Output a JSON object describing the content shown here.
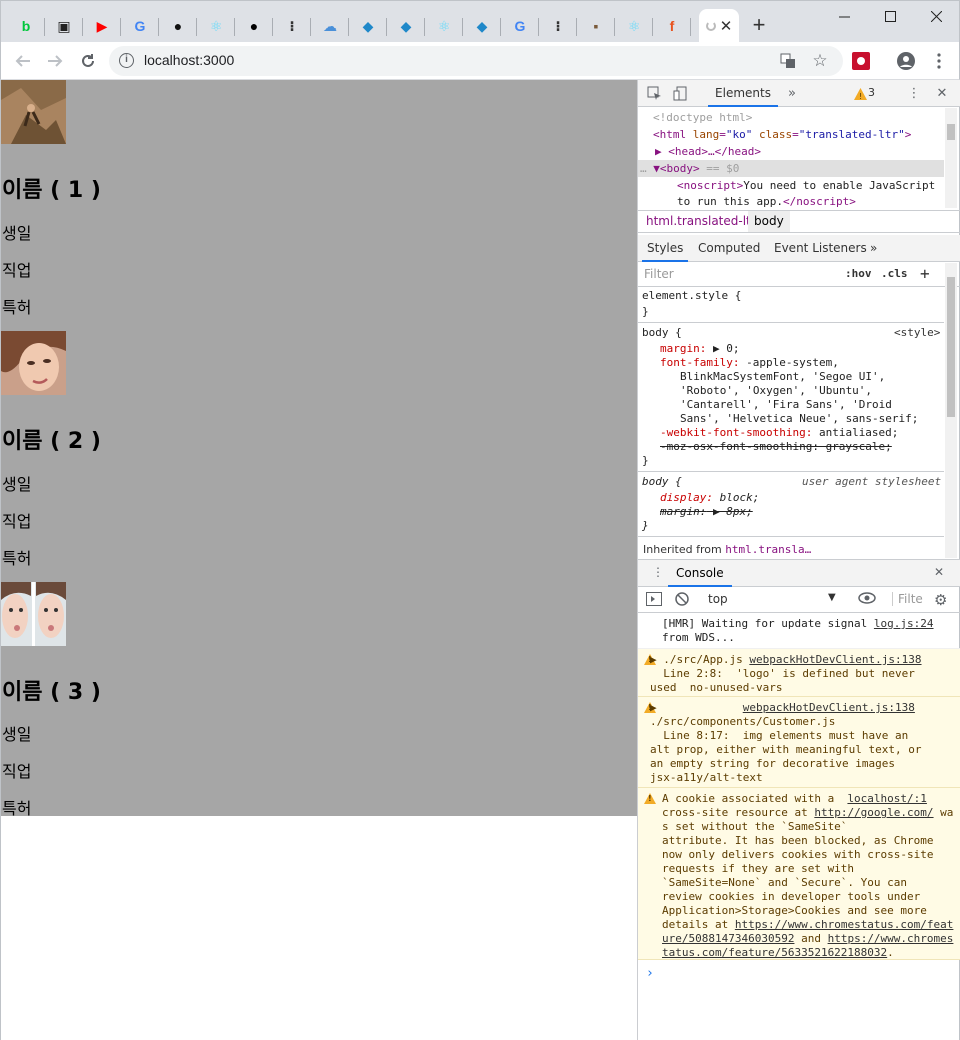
{
  "browser": {
    "url": "localhost:3000",
    "tabs": [
      {
        "icon": "line-blog-favicon",
        "color": "#00c73c",
        "glyph": "b"
      },
      {
        "icon": "codesandbox-favicon",
        "color": "#222222",
        "glyph": "▣"
      },
      {
        "icon": "youtube-favicon",
        "color": "#ff0000",
        "glyph": "▶"
      },
      {
        "icon": "google-favicon",
        "color": "#4285f4",
        "glyph": "G"
      },
      {
        "icon": "github-favicon",
        "color": "#111111",
        "glyph": "●"
      },
      {
        "icon": "react-favicon",
        "color": "#61dafb",
        "glyph": "⚛"
      },
      {
        "icon": "black-circle-favicon",
        "color": "#000000",
        "glyph": "●"
      },
      {
        "icon": "dots-favicon",
        "color": "#333333",
        "glyph": "⁝"
      },
      {
        "icon": "cloud-favicon",
        "color": "#4a90d9",
        "glyph": "☁"
      },
      {
        "icon": "panther-favicon",
        "color": "#1f88c9",
        "glyph": "◆"
      },
      {
        "icon": "panther-favicon",
        "color": "#1f88c9",
        "glyph": "◆"
      },
      {
        "icon": "react-favicon",
        "color": "#61dafb",
        "glyph": "⚛"
      },
      {
        "icon": "panther-favicon",
        "color": "#1f88c9",
        "glyph": "◆"
      },
      {
        "icon": "google-favicon",
        "color": "#4285f4",
        "glyph": "G"
      },
      {
        "icon": "dots-favicon",
        "color": "#333333",
        "glyph": "⁝"
      },
      {
        "icon": "photo-favicon",
        "color": "#7a5a3a",
        "glyph": "▪"
      },
      {
        "icon": "react-favicon",
        "color": "#61dafb",
        "glyph": "⚛"
      },
      {
        "icon": "orange-logo-favicon",
        "color": "#e8531f",
        "glyph": "f"
      }
    ],
    "active_tab_close": "✕",
    "new_tab": "+"
  },
  "page": {
    "customers": [
      {
        "name": "이름 ( 1 )",
        "birthday": "생일",
        "job": "직업",
        "patent": "특허",
        "image": "rock-climber"
      },
      {
        "name": "이름 ( 2 )",
        "birthday": "생일",
        "job": "직업",
        "patent": "특허",
        "image": "face-portrait"
      },
      {
        "name": "이름 ( 3 )",
        "birthday": "생일",
        "job": "직업",
        "patent": "특허",
        "image": "twin-faces"
      }
    ]
  },
  "devtools": {
    "tab_elements": "Elements",
    "warning_count": "3",
    "dom": {
      "doctype": "<!doctype html>",
      "html_tag": "html",
      "html_lang_attr": "lang",
      "html_lang_val": "\"ko\"",
      "html_class_attr": "class",
      "html_class_val": "\"translated-ltr\"",
      "head": "<head>…</head>",
      "body": "<body>",
      "body_eq": "== $0",
      "noscript_open": "<noscript>",
      "noscript_text": "You need to enable JavaScript",
      "noscript_text2": "to run this app.",
      "noscript_close": "</noscript>"
    },
    "breadcrumbs": [
      "html.translated-ltr",
      "body"
    ],
    "subtabs": [
      "Styles",
      "Computed",
      "Event Listeners"
    ],
    "filter_placeholder": "Filter",
    "hov": ":hov",
    "cls": ".cls",
    "styles": {
      "element_style": "element.style {",
      "close": "}",
      "body_rule": "body {",
      "style_source": "<style>",
      "margin": "margin:",
      "margin_val": "▶ 0;",
      "font_family": "font-family:",
      "font_family_val1": "-apple-system,",
      "font_family_val2": "BlinkMacSystemFont, 'Segoe UI',",
      "font_family_val3": "'Roboto', 'Oxygen', 'Ubuntu',",
      "font_family_val4": "'Cantarell', 'Fira Sans', 'Droid",
      "font_family_val5": "Sans', 'Helvetica Neue', sans-serif;",
      "webkit_smoothing": "-webkit-font-smoothing:",
      "webkit_smoothing_val": "antialiased;",
      "moz_smoothing": "-moz-osx-font-smoothing: grayscale;",
      "ua_body": "body {",
      "ua_source": "user agent stylesheet",
      "display": "display:",
      "display_val": "block;",
      "ua_margin": "margin:",
      "ua_margin_val": "▶ 8px;",
      "inherited": "Inherited from",
      "inherited_el": "html.transla…"
    },
    "console_tab": "Console",
    "context": "top",
    "console_filter": "Filte",
    "messages": {
      "hmr_text": "[HMR] Waiting for update signal ",
      "hmr_link": "log.js:24",
      "hmr_text2": "from WDS...",
      "w1_path": "▶ ./src/App.js ",
      "w1_link": "webpackHotDevClient.js:138",
      "w1_text": "  Line 2:8:  'logo' is defined but never\nused  no-unused-vars",
      "w2_arrow": "▶",
      "w2_link": "webpackHotDevClient.js:138",
      "w2_text": "./src/components/Customer.js\n  Line 8:17:  img elements must have an\nalt prop, either with meaningful text, or\nan empty string for decorative images\njsx-a11y/alt-text",
      "w3_text1": "A cookie associated with a  ",
      "w3_link": "localhost/:1",
      "w3_text2": "cross-site resource at ",
      "w3_url": "http://google.com/",
      "w3_text3": " was set without the `SameSite`\nattribute. It has been blocked, as Chrome\nnow only delivers cookies with cross-site\nrequests if they are set with\n`SameSite=None` and `Secure`. You can\nreview cookies in developer tools under\nApplication>Storage>Cookies and see more\ndetails at ",
      "w3_url2": "https://www.chromestatus.com/feature/5088147346030592",
      "w3_and": " and ",
      "w3_url3": "https://www.chromestatus.com/feature/5633521622188032",
      "w3_end": "."
    },
    "prompt": "›"
  }
}
